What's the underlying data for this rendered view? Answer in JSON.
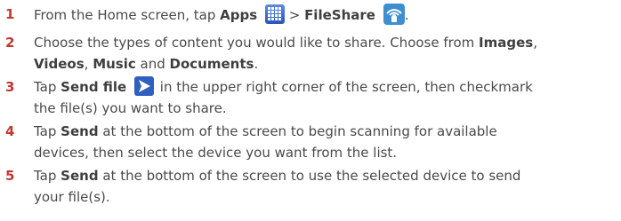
{
  "accent_color": "#c3372f",
  "text_color": "#4a4a4a",
  "icons": {
    "apps": "apps-grid-icon",
    "fileshare": "fileshare-wifi-icon",
    "send_file": "send-arrow-icon"
  },
  "steps": [
    {
      "number": "1",
      "line1_a": "From the Home screen, tap ",
      "apps_label": "Apps",
      "separator": " > ",
      "fileshare_label": "FileShare",
      "line1_end": "."
    },
    {
      "number": "2",
      "line1_a": "Choose the types of content you would like to share. Choose from ",
      "images_label": "Images",
      "line1_end": ",",
      "videos_label": "Videos",
      "comma": ", ",
      "music_label": "Music",
      "and_text": " and ",
      "documents_label": "Documents",
      "line2_end": "."
    },
    {
      "number": "3",
      "line1_a": "Tap ",
      "send_file_label": "Send file",
      "line1_b": " in the upper right corner of the screen, then checkmark",
      "line2": "the file(s) you want to share."
    },
    {
      "number": "4",
      "line1_a": "Tap ",
      "send_label": "Send",
      "line1_b": " at the bottom of the screen to begin scanning for available",
      "line2": "devices, then select the device you want from the list."
    },
    {
      "number": "5",
      "line1_a": "Tap ",
      "send_label": "Send",
      "line1_b": " at the bottom of the screen to use the selected device to send",
      "line2": "your file(s)."
    }
  ]
}
